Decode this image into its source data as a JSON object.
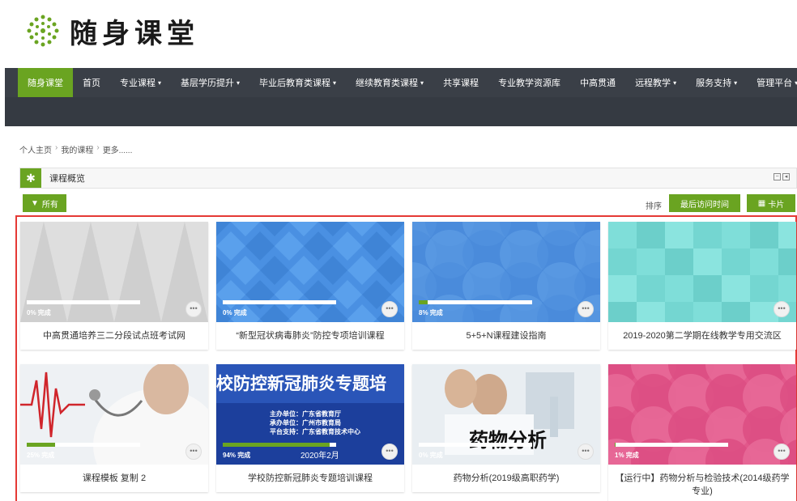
{
  "logo": {
    "text": "随身课堂"
  },
  "nav": {
    "items": [
      {
        "label": "随身课堂",
        "caret": "",
        "active": true
      },
      {
        "label": "首页",
        "caret": ""
      },
      {
        "label": "专业课程",
        "caret": "▾"
      },
      {
        "label": "基层学历提升",
        "caret": "▾"
      },
      {
        "label": "毕业后教育类课程",
        "caret": "▾"
      },
      {
        "label": "继续教育类课程",
        "caret": "▾"
      },
      {
        "label": "共享课程",
        "caret": ""
      },
      {
        "label": "专业教学资源库",
        "caret": ""
      },
      {
        "label": "中高贯通",
        "caret": ""
      },
      {
        "label": "远程教学",
        "caret": "▾"
      },
      {
        "label": "服务支持",
        "caret": "▾"
      },
      {
        "label": "管理平台",
        "caret": "▾"
      }
    ]
  },
  "breadcrumb": {
    "items": [
      "个人主页",
      "我的课程",
      "更多......"
    ],
    "sep": "›"
  },
  "block": {
    "title": "课程概览",
    "icon": "asterisk-icon"
  },
  "filter": {
    "label": "所有",
    "icon": "funnel-icon"
  },
  "sort": {
    "label": "排序",
    "button": "最后访问时间"
  },
  "view": {
    "label": "卡片",
    "icon": "grid-icon"
  },
  "colors": {
    "accent": "#6aa421",
    "nav_bg": "#3a3f47",
    "highlight_border": "#e53935"
  },
  "courses": [
    {
      "title": "中高贯通培养三二分段试点班考试网",
      "progress": 0,
      "progress_label": "0% 完成",
      "more": "•••",
      "image": "gray-triangles"
    },
    {
      "title": "“新型冠状病毒肺炎”防控专项培训课程",
      "progress": 0,
      "progress_label": "0% 完成",
      "more": "•••",
      "image": "blue-diamonds"
    },
    {
      "title": "5+5+N课程建设指南",
      "progress": 8,
      "progress_label": "8% 完成",
      "more": "•••",
      "image": "blue-circles"
    },
    {
      "title": "2019-2020第二学期在线教学专用交流区",
      "progress": null,
      "progress_label": "",
      "more": "•••",
      "image": "teal-squares"
    },
    {
      "title": "课程模板 复制 2",
      "progress": 25,
      "progress_label": "25% 完成",
      "more": "•••",
      "image": "doctor-photo"
    },
    {
      "title": "学校防控新冠肺炎专题培训课程",
      "progress": 94,
      "progress_label": "94% 完成",
      "more": "•••",
      "image": "covid-banner",
      "banner": {
        "headline": "校防控新冠肺炎专题培",
        "lines": [
          "主办单位：广东省教育厅",
          "承办单位：广州市教育局",
          "平台支持：广东省教育技术中心"
        ],
        "date": "2020年2月"
      }
    },
    {
      "title": "药物分析(2019级高职药学)",
      "progress": 0,
      "progress_label": "0% 完成",
      "more": "•••",
      "image": "lab-photo",
      "banner": {
        "headline": "药物分析"
      }
    },
    {
      "title": "【运行中】药物分析与检验技术(2014级药学专业)",
      "progress": 1,
      "progress_label": "1% 完成",
      "more": "•••",
      "image": "pink-circles"
    }
  ]
}
